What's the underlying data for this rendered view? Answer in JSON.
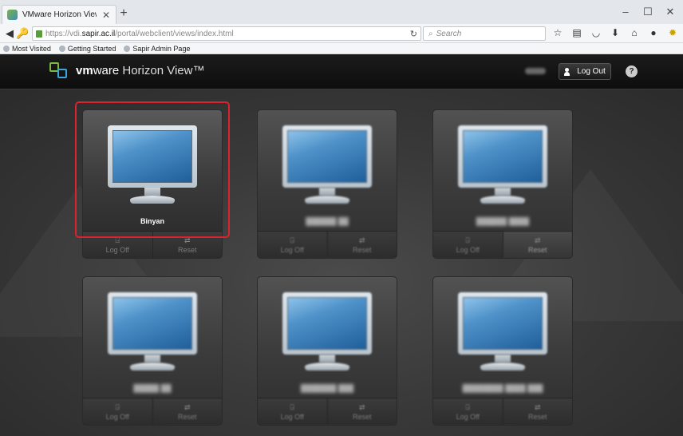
{
  "browser": {
    "tab_title": "VMware Horizon View",
    "new_tab": "+",
    "window_controls": [
      "–",
      "☐",
      "✕"
    ],
    "url_prefix": "https://vdi.",
    "url_host": "sapir.ac.il",
    "url_path": "/portal/webclient/views/index.html",
    "search_placeholder": "Search",
    "bookmarks": [
      "Most Visited",
      "Getting Started",
      "Sapir Admin Page"
    ]
  },
  "header": {
    "brand_vm": "vm",
    "brand_ware": "ware",
    "brand_product": " Horizon View™",
    "logout_label": "Log Out",
    "help_label": "?"
  },
  "desktops": [
    {
      "name": "Binyan",
      "logoff": "Log Off",
      "reset": "Reset"
    },
    {
      "name": "",
      "logoff": "Log Off",
      "reset": "Reset"
    },
    {
      "name": "",
      "logoff": "Log Off",
      "reset": "Reset"
    },
    {
      "name": "",
      "logoff": "Log Off",
      "reset": "Reset"
    },
    {
      "name": "",
      "logoff": "Log Off",
      "reset": "Reset"
    },
    {
      "name": "",
      "logoff": "Log Off",
      "reset": "Reset"
    }
  ],
  "colors": {
    "highlight": "#d9232e",
    "header_bg": "#111111",
    "main_bg": "#3a3a3a",
    "logo_green": "#7dba43",
    "logo_blue": "#3aa6d9"
  }
}
